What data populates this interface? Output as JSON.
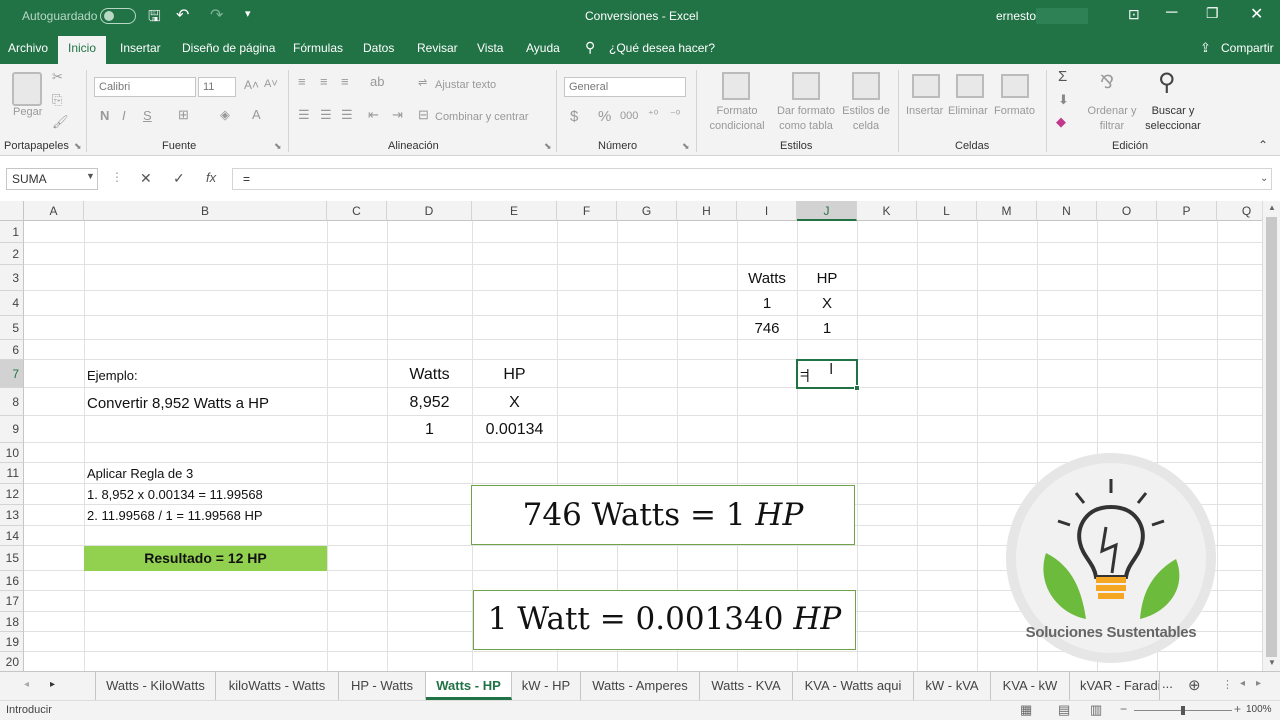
{
  "title_bar": {
    "autosave_label": "Autoguardado",
    "window_title": "Conversiones  -  Excel",
    "user": "ernesto"
  },
  "tabs": [
    "Archivo",
    "Inicio",
    "Insertar",
    "Diseño de página",
    "Fórmulas",
    "Datos",
    "Revisar",
    "Vista",
    "Ayuda"
  ],
  "active_tab": "Inicio",
  "tell_me": "¿Qué desea hacer?",
  "share": "Compartir",
  "ribbon": {
    "clipboard": {
      "paste": "Pegar",
      "group": "Portapapeles"
    },
    "font": {
      "name": "Calibri",
      "size": "11",
      "bold": "N",
      "italic": "I",
      "underline": "S",
      "group": "Fuente"
    },
    "alignment": {
      "wrap": "Ajustar texto",
      "merge": "Combinar y centrar",
      "group": "Alineación"
    },
    "number": {
      "format": "General",
      "currency": "$",
      "percent": "%",
      "thousands": "000",
      "group": "Número"
    },
    "styles": {
      "conditional": "Formato condicional",
      "table": "Dar formato como tabla",
      "cell_styles": "Estilos de celda",
      "group": "Estilos"
    },
    "cells": {
      "insert": "Insertar",
      "delete": "Eliminar",
      "format": "Formato",
      "group": "Celdas"
    },
    "editing": {
      "sort": "Ordenar y filtrar",
      "find": "Buscar y seleccionar",
      "group": "Edición"
    }
  },
  "formula_bar": {
    "name_box": "SUMA",
    "cancel": "✕",
    "enter": "✓",
    "fx": "fx",
    "content": "="
  },
  "columns": [
    "A",
    "B",
    "C",
    "D",
    "E",
    "F",
    "G",
    "H",
    "I",
    "J",
    "K",
    "L",
    "M",
    "N",
    "O",
    "P",
    "Q"
  ],
  "rows": [
    "1",
    "2",
    "3",
    "4",
    "5",
    "6",
    "7",
    "8",
    "9",
    "10",
    "11",
    "12",
    "13",
    "14",
    "15",
    "16",
    "17",
    "18",
    "19",
    "20"
  ],
  "cells": {
    "I3": "Watts",
    "J3": "HP",
    "I4": "1",
    "J4": "X",
    "I5": "746",
    "J5": "1",
    "B7": "Ejemplo:",
    "D7": "Watts",
    "E7": "HP",
    "J7": "=",
    "B8": "Convertir 8,952 Watts a HP",
    "D8": "8,952",
    "E8": "X",
    "D9": "1",
    "E9": "0.00134",
    "B11": "Aplicar Regla de 3",
    "B12": "1. 8,952 x 0.00134 = 11.99568",
    "B13": "2. 11.99568 / 1 = 11.99568 HP",
    "B15": "Resultado = 12 HP"
  },
  "equations": {
    "eq1_left": "746 Watts = 1 ",
    "eq1_unit": "HP",
    "eq2_left": "1 Watt = 0.001340 ",
    "eq2_unit": "HP"
  },
  "logo": {
    "text": "Soluciones Sustentables"
  },
  "sheet_tabs": [
    "Watts - KiloWatts",
    "kiloWatts - Watts",
    "HP - Watts",
    "Watts - HP",
    "kW - HP",
    "Watts - Amperes",
    "Watts - KVA",
    "KVA - Watts aqui",
    "kW - kVA",
    "KVA - kW",
    "kVAR - Faradi"
  ],
  "active_sheet": "Watts - HP",
  "status": {
    "mode": "Introducir",
    "zoom": "100%"
  },
  "colors": {
    "excel_green": "#217346",
    "result_fill": "#92d050",
    "selection": "#217346"
  }
}
